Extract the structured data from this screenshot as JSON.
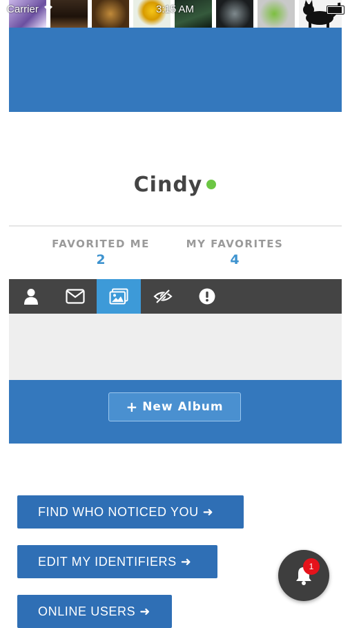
{
  "status_bar": {
    "carrier": "Carrier",
    "time": "3:15 AM"
  },
  "profile": {
    "username": "Cindy",
    "online": true
  },
  "stats": {
    "favorited_me": {
      "label": "FAVORITED ME",
      "value": "2"
    },
    "my_favorites": {
      "label": "MY FAVORITES",
      "value": "4"
    }
  },
  "tabs": [
    {
      "icon": "user-icon",
      "active": false
    },
    {
      "icon": "envelope-icon",
      "active": false
    },
    {
      "icon": "photos-icon",
      "active": true
    },
    {
      "icon": "eye-slash-icon",
      "active": false
    },
    {
      "icon": "exclamation-circle-icon",
      "active": false
    }
  ],
  "albums": {
    "new_album_label": "New Album"
  },
  "actions": {
    "find_who_noticed": "FIND WHO NOTICED YOU",
    "edit_identifiers": "EDIT MY IDENTIFIERS",
    "online_users": "ONLINE USERS"
  },
  "notifications": {
    "count": "1"
  },
  "colors": {
    "primary_blue": "#3478bd",
    "active_tab": "#3d9ad8",
    "tab_bar": "#444444",
    "online_green": "#6cc644",
    "badge_red": "#e5131b"
  }
}
